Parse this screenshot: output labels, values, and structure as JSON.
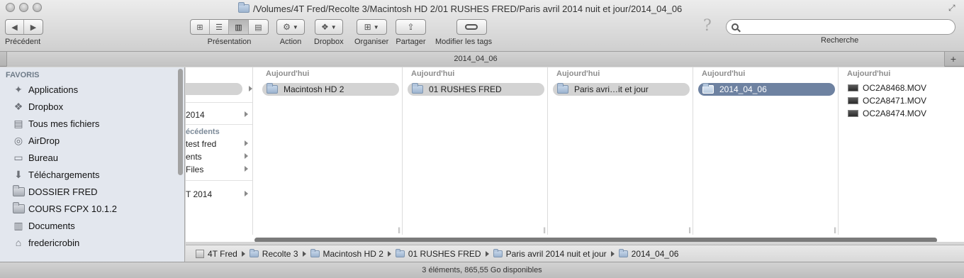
{
  "window": {
    "title": "/Volumes/4T Fred/Recolte 3/Macintosh HD 2/01 RUSHES FRED/Paris avril 2014 nuit et jour/2014_04_06"
  },
  "toolbar": {
    "back_label": "Précédent",
    "view_label": "Présentation",
    "action_label": "Action",
    "dropbox_label": "Dropbox",
    "arrange_label": "Organiser",
    "share_label": "Partager",
    "tags_label": "Modifier les tags",
    "search_label": "Recherche",
    "search_value": "",
    "search_placeholder": ""
  },
  "tab": {
    "title": "2014_04_06"
  },
  "sidebar": {
    "section": "FAVORIS",
    "items": [
      {
        "label": "Applications",
        "icon": "applications-icon"
      },
      {
        "label": "Dropbox",
        "icon": "dropbox-icon"
      },
      {
        "label": "Tous mes fichiers",
        "icon": "all-files-icon"
      },
      {
        "label": "AirDrop",
        "icon": "airdrop-icon"
      },
      {
        "label": "Bureau",
        "icon": "desktop-icon"
      },
      {
        "label": "Téléchargements",
        "icon": "downloads-icon"
      },
      {
        "label": "DOSSIER FRED",
        "icon": "folder-icon"
      },
      {
        "label": "COURS FCPX 10.1.2",
        "icon": "folder-icon"
      },
      {
        "label": "Documents",
        "icon": "documents-icon"
      },
      {
        "label": "fredericrobin",
        "icon": "home-icon"
      }
    ]
  },
  "columns": {
    "col0": {
      "rows": [
        "2014",
        "test fred",
        "ents",
        "Files",
        "T 2014"
      ],
      "subhead": "écédents"
    },
    "col1": {
      "header": "Aujourd'hui",
      "selected": "Macintosh HD 2"
    },
    "col2": {
      "header": "Aujourd'hui",
      "selected": "01 RUSHES FRED"
    },
    "col3": {
      "header": "Aujourd'hui",
      "selected": "Paris avri…it et jour"
    },
    "col4": {
      "header": "Aujourd'hui",
      "selected": "2014_04_06"
    },
    "col5": {
      "header": "Aujourd'hui",
      "files": [
        "OC2A8468.MOV",
        "OC2A8471.MOV",
        "OC2A8474.MOV"
      ]
    }
  },
  "pathbar": {
    "crumbs": [
      "4T Fred",
      "Recolte 3",
      "Macintosh HD 2",
      "01 RUSHES FRED",
      "Paris avril 2014 nuit et jour",
      "2014_04_06"
    ]
  },
  "status": {
    "text": "3 éléments, 865,55 Go disponibles"
  },
  "colors": {
    "selection_active": "#6e82a1",
    "selection_inactive": "#d3d3d3",
    "sidebar_bg": "#e3e7ee"
  }
}
